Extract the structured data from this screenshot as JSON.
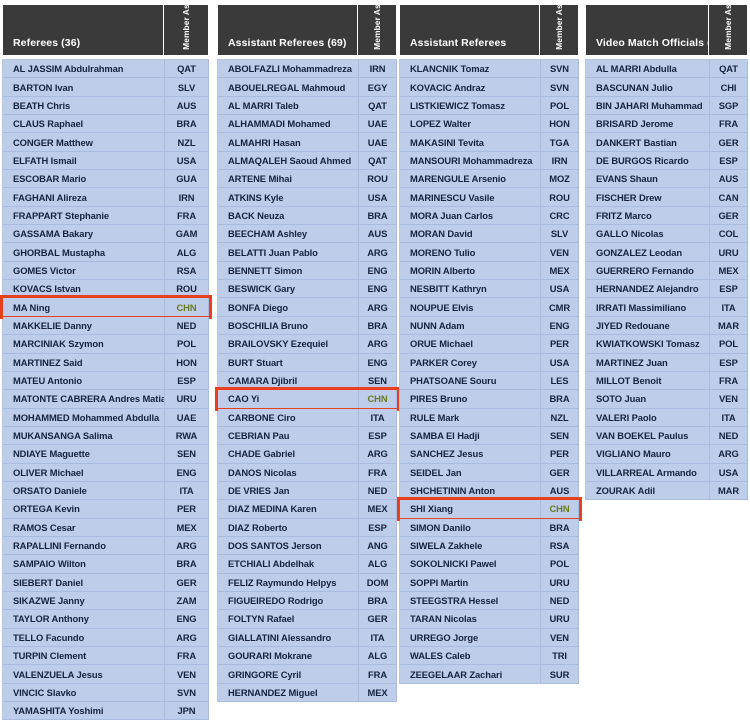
{
  "meta": {
    "member_association_header": "Member\nAssociation"
  },
  "columns": [
    {
      "id": "referees",
      "title": "Referees (36)",
      "ma_label_line1": "Member",
      "ma_label_line2": "Association",
      "rows": [
        {
          "name": "AL JASSIM Abdulrahman",
          "ma": "QAT",
          "highlight": false
        },
        {
          "name": "BARTON Ivan",
          "ma": "SLV",
          "highlight": false
        },
        {
          "name": "BEATH Chris",
          "ma": "AUS",
          "highlight": false
        },
        {
          "name": "CLAUS Raphael",
          "ma": "BRA",
          "highlight": false
        },
        {
          "name": "CONGER Matthew",
          "ma": "NZL",
          "highlight": false
        },
        {
          "name": "ELFATH Ismail",
          "ma": "USA",
          "highlight": false
        },
        {
          "name": "ESCOBAR Mario",
          "ma": "GUA",
          "highlight": false
        },
        {
          "name": "FAGHANI Alireza",
          "ma": "IRN",
          "highlight": false
        },
        {
          "name": "FRAPPART Stephanie",
          "ma": "FRA",
          "highlight": false
        },
        {
          "name": "GASSAMA Bakary",
          "ma": "GAM",
          "highlight": false
        },
        {
          "name": "GHORBAL Mustapha",
          "ma": "ALG",
          "highlight": false
        },
        {
          "name": "GOMES Victor",
          "ma": "RSA",
          "highlight": false
        },
        {
          "name": "KOVACS Istvan",
          "ma": "ROU",
          "highlight": false
        },
        {
          "name": "MA Ning",
          "ma": "CHN",
          "highlight": true
        },
        {
          "name": "MAKKELIE Danny",
          "ma": "NED",
          "highlight": false
        },
        {
          "name": "MARCINIAK Szymon",
          "ma": "POL",
          "highlight": false
        },
        {
          "name": "MARTINEZ Said",
          "ma": "HON",
          "highlight": false
        },
        {
          "name": "MATEU Antonio",
          "ma": "ESP",
          "highlight": false
        },
        {
          "name": "MATONTE CABRERA Andres Matias",
          "ma": "URU",
          "highlight": false
        },
        {
          "name": "MOHAMMED Mohammed Abdulla",
          "ma": "UAE",
          "highlight": false
        },
        {
          "name": "MUKANSANGA Salima",
          "ma": "RWA",
          "highlight": false
        },
        {
          "name": "NDIAYE Maguette",
          "ma": "SEN",
          "highlight": false
        },
        {
          "name": "OLIVER Michael",
          "ma": "ENG",
          "highlight": false
        },
        {
          "name": "ORSATO Daniele",
          "ma": "ITA",
          "highlight": false
        },
        {
          "name": "ORTEGA Kevin",
          "ma": "PER",
          "highlight": false
        },
        {
          "name": "RAMOS Cesar",
          "ma": "MEX",
          "highlight": false
        },
        {
          "name": "RAPALLINI Fernando",
          "ma": "ARG",
          "highlight": false
        },
        {
          "name": "SAMPAIO Wilton",
          "ma": "BRA",
          "highlight": false
        },
        {
          "name": "SIEBERT Daniel",
          "ma": "GER",
          "highlight": false
        },
        {
          "name": "SIKAZWE Janny",
          "ma": "ZAM",
          "highlight": false
        },
        {
          "name": "TAYLOR Anthony",
          "ma": "ENG",
          "highlight": false
        },
        {
          "name": "TELLO Facundo",
          "ma": "ARG",
          "highlight": false
        },
        {
          "name": "TURPIN Clement",
          "ma": "FRA",
          "highlight": false
        },
        {
          "name": "VALENZUELA Jesus",
          "ma": "VEN",
          "highlight": false
        },
        {
          "name": "VINCIC Slavko",
          "ma": "SVN",
          "highlight": false
        },
        {
          "name": "YAMASHITA Yoshimi",
          "ma": "JPN",
          "highlight": false
        }
      ]
    },
    {
      "id": "assistants-1",
      "title": "Assistant Referees (69)",
      "ma_label_line1": "Member",
      "ma_label_line2": "Association",
      "rows": [
        {
          "name": "ABOLFAZLI Mohammadreza",
          "ma": "IRN",
          "highlight": false
        },
        {
          "name": "ABOUELREGAL Mahmoud",
          "ma": "EGY",
          "highlight": false
        },
        {
          "name": "AL MARRI Taleb",
          "ma": "QAT",
          "highlight": false
        },
        {
          "name": "ALHAMMADI Mohamed",
          "ma": "UAE",
          "highlight": false
        },
        {
          "name": "ALMAHRI Hasan",
          "ma": "UAE",
          "highlight": false
        },
        {
          "name": "ALMAQALEH Saoud Ahmed",
          "ma": "QAT",
          "highlight": false
        },
        {
          "name": "ARTENE Mihai",
          "ma": "ROU",
          "highlight": false
        },
        {
          "name": "ATKINS Kyle",
          "ma": "USA",
          "highlight": false
        },
        {
          "name": "BACK Neuza",
          "ma": "BRA",
          "highlight": false
        },
        {
          "name": "BEECHAM Ashley",
          "ma": "AUS",
          "highlight": false
        },
        {
          "name": "BELATTI Juan Pablo",
          "ma": "ARG",
          "highlight": false
        },
        {
          "name": "BENNETT Simon",
          "ma": "ENG",
          "highlight": false
        },
        {
          "name": "BESWICK Gary",
          "ma": "ENG",
          "highlight": false
        },
        {
          "name": "BONFA Diego",
          "ma": "ARG",
          "highlight": false
        },
        {
          "name": "BOSCHILIA Bruno",
          "ma": "BRA",
          "highlight": false
        },
        {
          "name": "BRAILOVSKY Ezequiel",
          "ma": "ARG",
          "highlight": false
        },
        {
          "name": "BURT Stuart",
          "ma": "ENG",
          "highlight": false
        },
        {
          "name": "CAMARA Djibril",
          "ma": "SEN",
          "highlight": false
        },
        {
          "name": "CAO Yi",
          "ma": "CHN",
          "highlight": true
        },
        {
          "name": "CARBONE Ciro",
          "ma": "ITA",
          "highlight": false
        },
        {
          "name": "CEBRIAN Pau",
          "ma": "ESP",
          "highlight": false
        },
        {
          "name": "CHADE Gabriel",
          "ma": "ARG",
          "highlight": false
        },
        {
          "name": "DANOS Nicolas",
          "ma": "FRA",
          "highlight": false
        },
        {
          "name": "DE VRIES Jan",
          "ma": "NED",
          "highlight": false
        },
        {
          "name": "DIAZ MEDINA Karen",
          "ma": "MEX",
          "highlight": false
        },
        {
          "name": "DIAZ Roberto",
          "ma": "ESP",
          "highlight": false
        },
        {
          "name": "DOS SANTOS Jerson",
          "ma": "ANG",
          "highlight": false
        },
        {
          "name": "ETCHIALI Abdelhak",
          "ma": "ALG",
          "highlight": false
        },
        {
          "name": "FELIZ Raymundo Helpys",
          "ma": "DOM",
          "highlight": false
        },
        {
          "name": "FIGUEIREDO Rodrigo",
          "ma": "BRA",
          "highlight": false
        },
        {
          "name": "FOLTYN Rafael",
          "ma": "GER",
          "highlight": false
        },
        {
          "name": "GIALLATINI Alessandro",
          "ma": "ITA",
          "highlight": false
        },
        {
          "name": "GOURARI Mokrane",
          "ma": "ALG",
          "highlight": false
        },
        {
          "name": "GRINGORE Cyril",
          "ma": "FRA",
          "highlight": false
        },
        {
          "name": "HERNANDEZ Miguel",
          "ma": "MEX",
          "highlight": false
        }
      ]
    },
    {
      "id": "assistants-2",
      "title": "Assistant Referees",
      "ma_label_line1": "Member",
      "ma_label_line2": "Association",
      "rows": [
        {
          "name": "KLANCNIK Tomaz",
          "ma": "SVN",
          "highlight": false
        },
        {
          "name": "KOVACIC Andraz",
          "ma": "SVN",
          "highlight": false
        },
        {
          "name": "LISTKIEWICZ Tomasz",
          "ma": "POL",
          "highlight": false
        },
        {
          "name": "LOPEZ Walter",
          "ma": "HON",
          "highlight": false
        },
        {
          "name": "MAKASINI Tevita",
          "ma": "TGA",
          "highlight": false
        },
        {
          "name": "MANSOURI Mohammadreza",
          "ma": "IRN",
          "highlight": false
        },
        {
          "name": "MARENGULE Arsenio",
          "ma": "MOZ",
          "highlight": false
        },
        {
          "name": "MARINESCU Vasile",
          "ma": "ROU",
          "highlight": false
        },
        {
          "name": "MORA Juan Carlos",
          "ma": "CRC",
          "highlight": false
        },
        {
          "name": "MORAN David",
          "ma": "SLV",
          "highlight": false
        },
        {
          "name": "MORENO Tulio",
          "ma": "VEN",
          "highlight": false
        },
        {
          "name": "MORIN Alberto",
          "ma": "MEX",
          "highlight": false
        },
        {
          "name": "NESBITT Kathryn",
          "ma": "USA",
          "highlight": false
        },
        {
          "name": "NOUPUE Elvis",
          "ma": "CMR",
          "highlight": false
        },
        {
          "name": "NUNN Adam",
          "ma": "ENG",
          "highlight": false
        },
        {
          "name": "ORUE Michael",
          "ma": "PER",
          "highlight": false
        },
        {
          "name": "PARKER Corey",
          "ma": "USA",
          "highlight": false
        },
        {
          "name": "PHATSOANE Souru",
          "ma": "LES",
          "highlight": false
        },
        {
          "name": "PIRES Bruno",
          "ma": "BRA",
          "highlight": false
        },
        {
          "name": "RULE Mark",
          "ma": "NZL",
          "highlight": false
        },
        {
          "name": "SAMBA El Hadji",
          "ma": "SEN",
          "highlight": false
        },
        {
          "name": "SANCHEZ Jesus",
          "ma": "PER",
          "highlight": false
        },
        {
          "name": "SEIDEL Jan",
          "ma": "GER",
          "highlight": false
        },
        {
          "name": "SHCHETININ Anton",
          "ma": "AUS",
          "highlight": false
        },
        {
          "name": "SHI Xiang",
          "ma": "CHN",
          "highlight": true
        },
        {
          "name": "SIMON Danilo",
          "ma": "BRA",
          "highlight": false
        },
        {
          "name": "SIWELA Zakhele",
          "ma": "RSA",
          "highlight": false
        },
        {
          "name": "SOKOLNICKI Pawel",
          "ma": "POL",
          "highlight": false
        },
        {
          "name": "SOPPI  Martin",
          "ma": "URU",
          "highlight": false
        },
        {
          "name": "STEEGSTRA Hessel",
          "ma": "NED",
          "highlight": false
        },
        {
          "name": "TARAN Nicolas",
          "ma": "URU",
          "highlight": false
        },
        {
          "name": "URREGO Jorge",
          "ma": "VEN",
          "highlight": false
        },
        {
          "name": "WALES Caleb",
          "ma": "TRI",
          "highlight": false
        },
        {
          "name": "ZEEGELAAR Zachari",
          "ma": "SUR",
          "highlight": false
        }
      ]
    },
    {
      "id": "vmo",
      "title": "Video Match Officials (24)",
      "ma_label_line1": "Member",
      "ma_label_line2": "Association",
      "rows": [
        {
          "name": "AL MARRI Abdulla",
          "ma": "QAT",
          "highlight": false
        },
        {
          "name": "BASCUNAN Julio",
          "ma": "CHI",
          "highlight": false
        },
        {
          "name": "BIN JAHARI Muhammad",
          "ma": "SGP",
          "highlight": false
        },
        {
          "name": "BRISARD Jerome",
          "ma": "FRA",
          "highlight": false
        },
        {
          "name": "DANKERT Bastian",
          "ma": "GER",
          "highlight": false
        },
        {
          "name": "DE BURGOS Ricardo",
          "ma": "ESP",
          "highlight": false
        },
        {
          "name": "EVANS Shaun",
          "ma": "AUS",
          "highlight": false
        },
        {
          "name": "FISCHER Drew",
          "ma": "CAN",
          "highlight": false
        },
        {
          "name": "FRITZ Marco",
          "ma": "GER",
          "highlight": false
        },
        {
          "name": "GALLO Nicolas",
          "ma": "COL",
          "highlight": false
        },
        {
          "name": "GONZALEZ Leodan",
          "ma": "URU",
          "highlight": false
        },
        {
          "name": "GUERRERO Fernando",
          "ma": "MEX",
          "highlight": false
        },
        {
          "name": "HERNANDEZ Alejandro",
          "ma": "ESP",
          "highlight": false
        },
        {
          "name": "IRRATI Massimiliano",
          "ma": "ITA",
          "highlight": false
        },
        {
          "name": "JIYED Redouane",
          "ma": "MAR",
          "highlight": false
        },
        {
          "name": "KWIATKOWSKI Tomasz",
          "ma": "POL",
          "highlight": false
        },
        {
          "name": "MARTINEZ Juan",
          "ma": "ESP",
          "highlight": false
        },
        {
          "name": "MILLOT Benoit",
          "ma": "FRA",
          "highlight": false
        },
        {
          "name": "SOTO Juan",
          "ma": "VEN",
          "highlight": false
        },
        {
          "name": "VALERI Paolo",
          "ma": "ITA",
          "highlight": false
        },
        {
          "name": "VAN BOEKEL Paulus",
          "ma": "NED",
          "highlight": false
        },
        {
          "name": "VIGLIANO Mauro",
          "ma": "ARG",
          "highlight": false
        },
        {
          "name": "VILLARREAL Armando",
          "ma": "USA",
          "highlight": false
        },
        {
          "name": "ZOURAK Adil",
          "ma": "MAR",
          "highlight": false
        }
      ]
    }
  ],
  "colors": {
    "header_bg": "#3a3a3a",
    "row_bg": "#bdcdea",
    "row_border": "#a9bce0",
    "text": "#16233d",
    "highlight_border": "#e8401f",
    "highlight_ma_text": "#6b7a1f"
  }
}
